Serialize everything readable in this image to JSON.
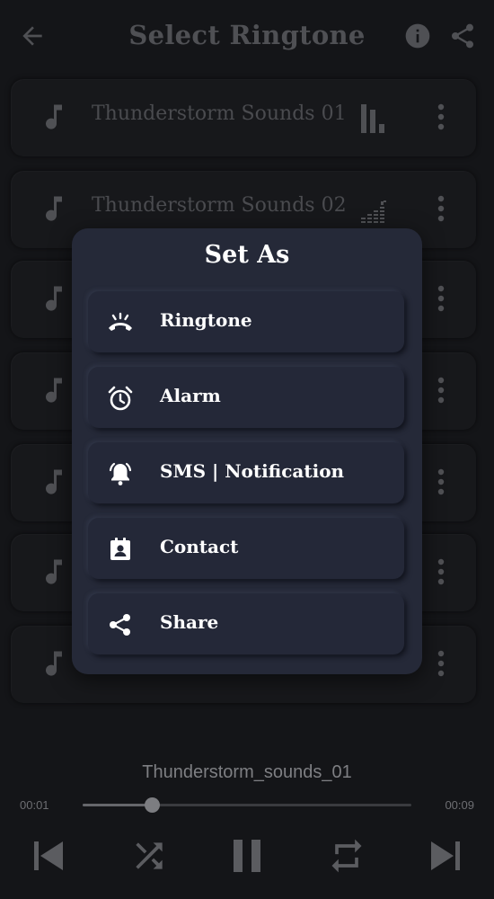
{
  "header": {
    "title": "Select Ringtone",
    "back_icon": "arrow-left-icon",
    "info_icon": "info-icon",
    "share_icon": "share-icon"
  },
  "ringtones": [
    {
      "name": "Thunderstorm Sounds 01",
      "playing": true
    },
    {
      "name": "Thunderstorm Sounds 02",
      "playing": false
    },
    {
      "name": "",
      "playing": false
    },
    {
      "name": "",
      "playing": false
    },
    {
      "name": "",
      "playing": false
    },
    {
      "name": "",
      "playing": false
    },
    {
      "name": "",
      "playing": false
    }
  ],
  "dialog": {
    "title": "Set As",
    "options": [
      {
        "label": "Ringtone",
        "icon": "phone-ring-icon"
      },
      {
        "label": "Alarm",
        "icon": "alarm-clock-icon"
      },
      {
        "label": "SMS | Notification",
        "icon": "bell-ring-icon"
      },
      {
        "label": "Contact",
        "icon": "contact-card-icon"
      },
      {
        "label": "Share",
        "icon": "share-icon"
      }
    ]
  },
  "player": {
    "now_playing": "Thunderstorm_sounds_01",
    "current_time": "00:01",
    "duration": "00:09",
    "progress_fraction": 0.21
  },
  "colors": {
    "background": "#141518",
    "dialog_bg": "#252938",
    "dialog_text": "#ffffff",
    "muted_text": "#4f5054"
  }
}
